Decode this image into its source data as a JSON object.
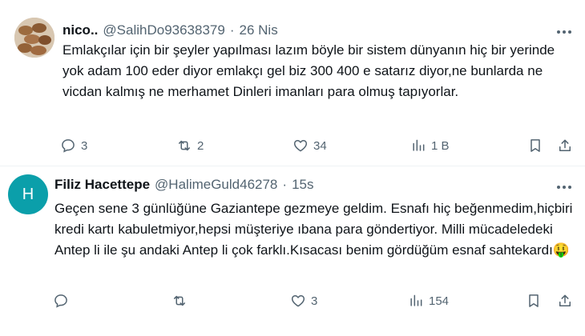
{
  "tweets": [
    {
      "display_name": "nico..",
      "handle": "@SalihDo93638379",
      "separator": "·",
      "time": "26 Nis",
      "text": "Emlakçılar için bir şeyler yapılması lazım böyle bir sistem dünyanın hiç bir yerinde yok adam 100 eder diyor emlakçı gel biz 300  400 e satarız diyor,ne bunlarda ne vicdan kalmış ne merhamet Dinleri imanları para olmuş tapıyorlar.",
      "avatar_color": "#c9b8a4",
      "actions": {
        "replies": "3",
        "reposts": "2",
        "likes": "34",
        "views": "1 B"
      }
    },
    {
      "display_name": "Filiz Hacettepe",
      "handle": "@HalimeGuld46278",
      "separator": "·",
      "time": "15s",
      "avatar_letter": "H",
      "avatar_color": "#0b9faa",
      "text": "Geçen sene 3 günlüğüne Gaziantepe gezmeye geldim. Esnafı hiç beğenmedim,hiçbiri kredi kartı kabuletmiyor,hepsi müşteriye ıbana para göndertiyor. Milli mücadeledeki Antep li  ile şu andaki Antep li  çok farklı.Kısacası benim gördüğüm esnaf sahtekardı🤑",
      "actions": {
        "replies": "",
        "reposts": "",
        "likes": "3",
        "views": "154"
      }
    }
  ],
  "colors": {
    "text": "#0f1419",
    "secondary": "#536471",
    "divider": "#eff3f4"
  },
  "icons": [
    "more-icon",
    "reply-icon",
    "repost-icon",
    "like-icon",
    "views-icon",
    "bookmark-icon",
    "share-icon"
  ]
}
